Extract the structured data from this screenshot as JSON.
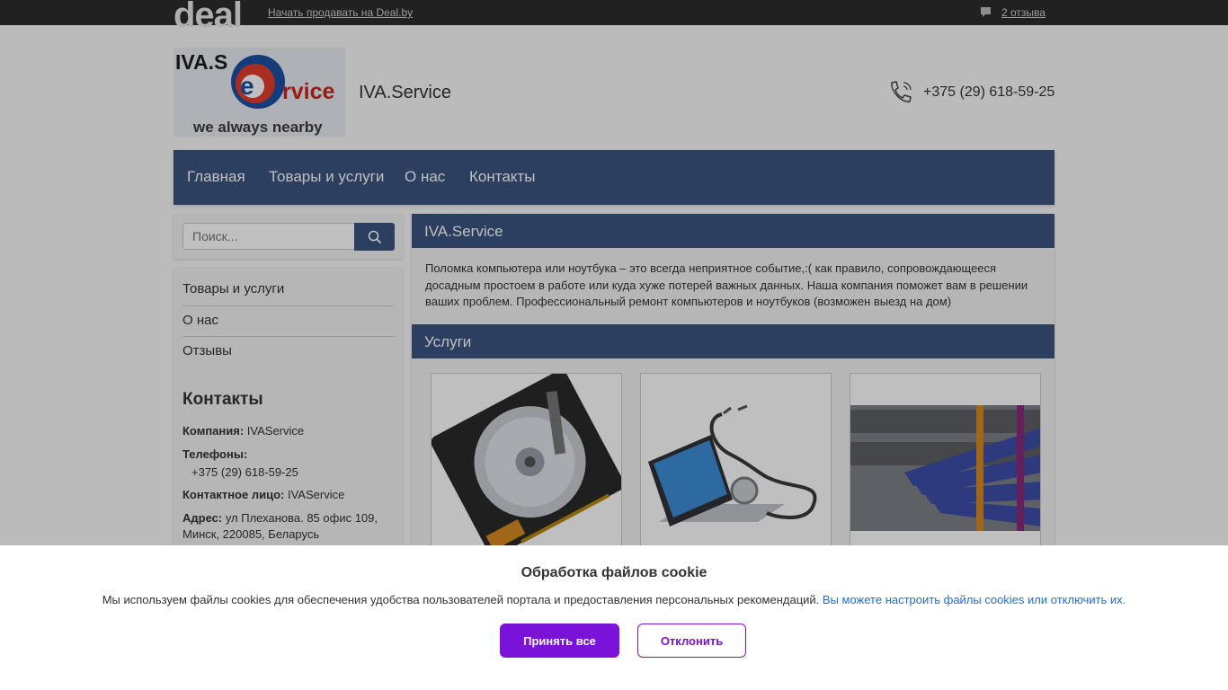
{
  "topbar": {
    "logo_text": "deal",
    "sell_link": "Начать продавать на Deal.by",
    "reviews_link": "2 отзыва"
  },
  "header": {
    "logo_top": "IVA.S",
    "logo_rest": "rvice",
    "logo_slogan": "we always nearby",
    "site_name": "IVA.Service",
    "phone": "+375 (29) 618-59-25"
  },
  "nav": {
    "items": [
      {
        "label": "Главная"
      },
      {
        "label": "Товары и услуги"
      },
      {
        "label": "О нас"
      },
      {
        "label": "Контакты"
      }
    ]
  },
  "search": {
    "placeholder": "Поиск..."
  },
  "sidebar": {
    "items": [
      {
        "label": "Товары и услуги"
      },
      {
        "label": "О нас"
      },
      {
        "label": "Отзывы"
      }
    ],
    "contacts_title": "Контакты",
    "company_label": "Компания:",
    "company_value": "IVAService",
    "phones_label": "Телефоны:",
    "phones_value": "+375 (29) 618-59-25",
    "contact_label": "Контактное лицо:",
    "contact_value": "IVAService",
    "address_label": "Адрес:",
    "address_value": "ул Плеханова. 85 офис 109, Минск, 220085, Беларусь"
  },
  "main": {
    "title": "IVA.Service",
    "intro": "Поломка компьютера или ноутбука – это всегда неприятное событие,:( как правило, сопровождающееся досадным простоем в работе или куда хуже потерей важных данных. Наша компания поможет вам в решении ваших проблем. Профессиональный ремонт компьютеров и ноутбуков (возможен выезд на дом)",
    "services_title": "Услуги"
  },
  "cookie": {
    "title": "Обработка файлов cookie",
    "text": "Мы используем файлы cookies для обеспечения удобства пользователей портала и предоставления персональных рекомендаций.",
    "link": "Вы можете настроить файлы cookies или отключить их.",
    "accept": "Принять все",
    "decline": "Отклонить"
  }
}
